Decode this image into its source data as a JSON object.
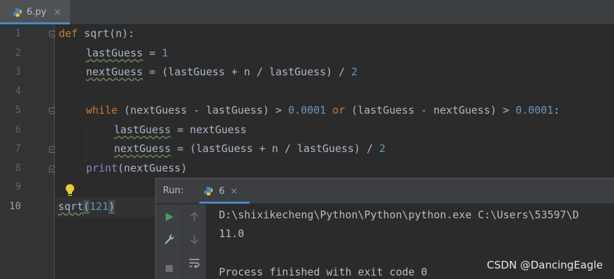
{
  "editor_tab": {
    "filename": "6.py",
    "close_glyph": "×"
  },
  "gutter": {
    "line_numbers": [
      "1",
      "2",
      "3",
      "4",
      "5",
      "6",
      "7",
      "8",
      "9",
      "10"
    ]
  },
  "code": {
    "line1": {
      "kw": "def",
      "name": "sqrt",
      "rest": "(n):"
    },
    "line2": {
      "var": "lastGuess",
      "op": " = ",
      "num": "1"
    },
    "line3": {
      "var": "nextGuess",
      "expr": " = (lastGuess + n / lastGuess) / ",
      "num": "2"
    },
    "line5": {
      "kw": "while",
      "expr1": " (nextGuess - lastGuess) > ",
      "num1": "0.0001",
      "kw2": " or",
      "expr2": " (lastGuess - nextGuess) > ",
      "num2": "0.0001",
      "colon": ":"
    },
    "line6": {
      "var": "lastGuess",
      "expr": " = nextGuess"
    },
    "line7": {
      "var": "nextGuess",
      "expr": " = (lastGuess + n / lastGuess) / ",
      "num": "2"
    },
    "line8": {
      "builtin": "print",
      "expr": "(nextGuess)"
    },
    "line10": {
      "call": "sqrt",
      "open": "(",
      "num": "121",
      "close": ")"
    }
  },
  "run_panel": {
    "title": "Run:",
    "tab_label": "6",
    "tab_close": "×",
    "output": [
      "D:\\shixikecheng\\Python\\Python\\python.exe C:\\Users\\53597\\D",
      "11.0",
      "",
      "Process finished with exit code 0"
    ]
  },
  "watermark": "CSDN @DancingEagle",
  "colors": {
    "accent": "#4a88c7",
    "run_green": "#499c54",
    "bulb": "#f0c92f"
  },
  "icons": [
    "python-file-icon",
    "fold-marker-icon",
    "lightbulb-icon",
    "run-icon",
    "wrench-icon",
    "stop-icon",
    "arrow-up-icon",
    "arrow-down-icon",
    "soft-wrap-icon"
  ]
}
